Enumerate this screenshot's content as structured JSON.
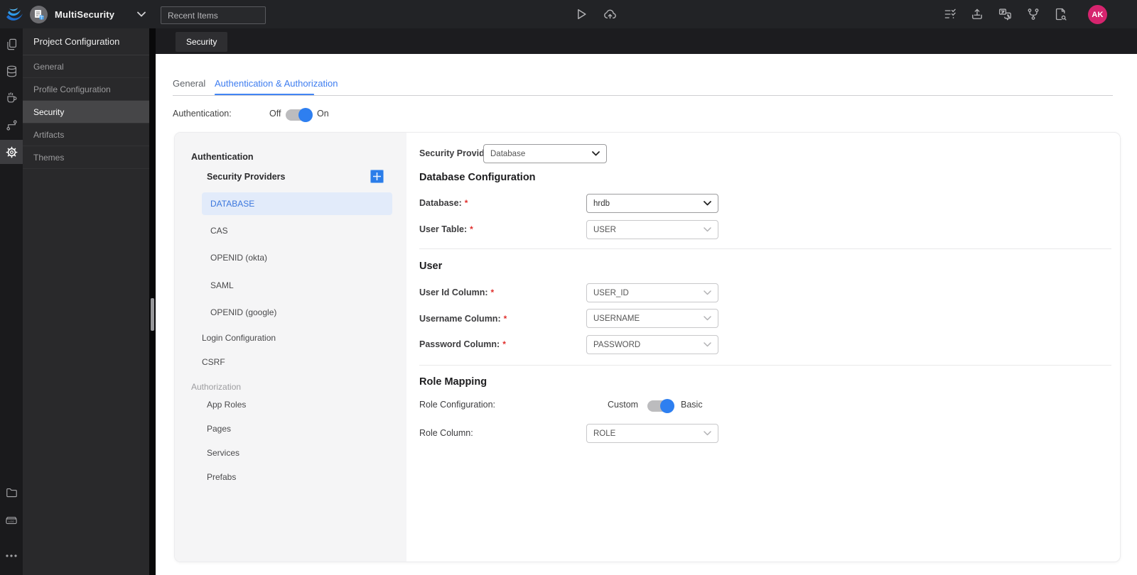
{
  "topbar": {
    "project_name": "MultiSecurity",
    "recent_items": "Recent Items",
    "avatar_initials": "AK"
  },
  "tabbar": {
    "active_tab": "Security"
  },
  "nav": {
    "title": "Project Configuration",
    "items": [
      "General",
      "Profile Configuration",
      "Security",
      "Artifacts",
      "Themes"
    ]
  },
  "tabs": {
    "general": "General",
    "auth": "Authentication & Authorization"
  },
  "auth_toggle": {
    "label": "Authentication:",
    "off": "Off",
    "on": "On"
  },
  "tree": {
    "authentication": "Authentication",
    "security_providers": "Security Providers",
    "providers": [
      "DATABASE",
      "CAS",
      "OPENID (okta)",
      "SAML",
      "OPENID (google)"
    ],
    "login_configuration": "Login Configuration",
    "csrf": "CSRF",
    "authorization": "Authorization",
    "auth_items": [
      "App Roles",
      "Pages",
      "Services",
      "Prefabs"
    ]
  },
  "form": {
    "required_marker": "*",
    "security_provider": {
      "label": "Security Provider",
      "value": "Database"
    },
    "db_heading": "Database Configuration",
    "database": {
      "label": "Database:",
      "value": "hrdb"
    },
    "user_table": {
      "label": "User Table:",
      "value": "USER"
    },
    "user_heading": "User",
    "user_id": {
      "label": "User Id Column:",
      "value": "USER_ID"
    },
    "username": {
      "label": "Username Column:",
      "value": "USERNAME"
    },
    "password": {
      "label": "Password Column:",
      "value": "PASSWORD"
    },
    "role_heading": "Role Mapping",
    "role_config": {
      "label": "Role Configuration:",
      "left": "Custom",
      "right": "Basic"
    },
    "role_column": {
      "label": "Role Column:",
      "value": "ROLE"
    }
  },
  "colors": {
    "accent_blue": "#2e7ff0",
    "tab_underline": "#4285f4",
    "selected_item_bg": "#e2ebfa",
    "selected_item_text": "#3b77dd",
    "avatar_pink": "#d6246e",
    "toggle_track": "#bcbcbe",
    "required_red": "#e0302d"
  }
}
